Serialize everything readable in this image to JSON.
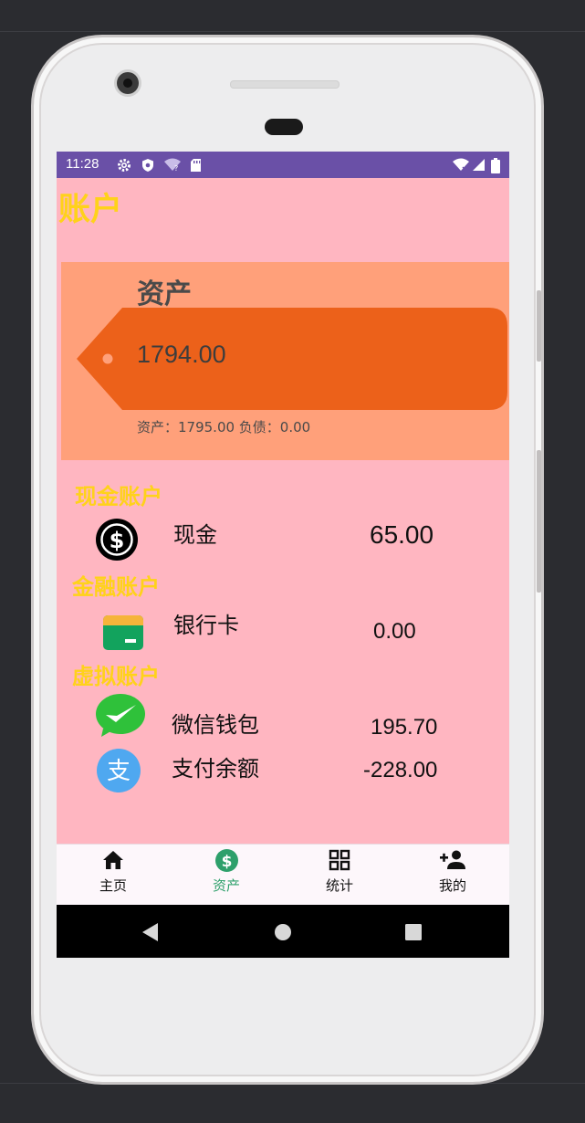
{
  "status_bar": {
    "time": "11:28"
  },
  "header": {
    "title": "账户"
  },
  "summary": {
    "label": "资产",
    "amount": "1794.00",
    "detail": "资产：1795.00    负债：0.00"
  },
  "sections": [
    {
      "title": "现金账户",
      "accounts": [
        {
          "name": "现金",
          "value": "65.00",
          "icon": "dollar-coin-icon"
        }
      ]
    },
    {
      "title": "金融账户",
      "accounts": [
        {
          "name": "银行卡",
          "value": "0.00",
          "icon": "bank-card-icon"
        }
      ]
    },
    {
      "title": "虚拟账户",
      "accounts": [
        {
          "name": "微信钱包",
          "value": "195.70",
          "icon": "wechat-icon"
        },
        {
          "name": "支付余额",
          "value": "-228.00",
          "icon": "alipay-icon"
        }
      ]
    }
  ],
  "bottom_nav": [
    {
      "label": "主页",
      "icon": "home-icon"
    },
    {
      "label": "资产",
      "icon": "dollar-circle-icon",
      "active": true
    },
    {
      "label": "统计",
      "icon": "grid-icon"
    },
    {
      "label": "我的",
      "icon": "add-person-icon"
    }
  ],
  "colors": {
    "status_bar": "#6a50a7",
    "background": "#ffb6c1",
    "card": "#ffa07a",
    "tag": "#ec611a",
    "section_title": "#ffd21a",
    "nav_active": "#2ea06b"
  }
}
